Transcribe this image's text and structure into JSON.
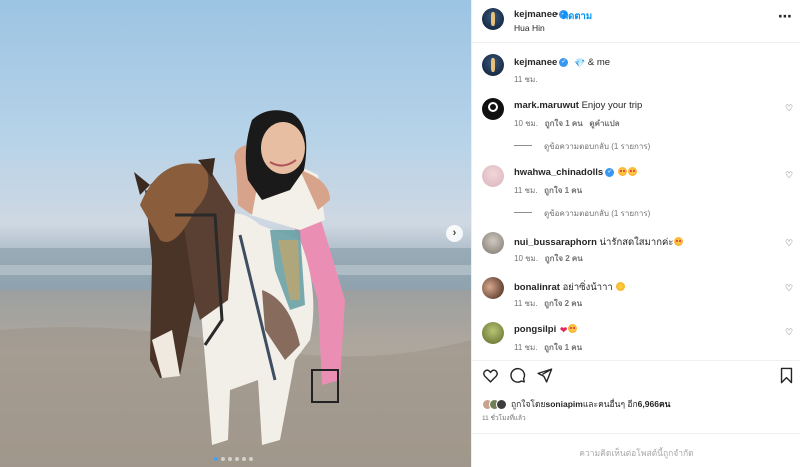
{
  "header": {
    "username": "kejmanee",
    "follow_label": "ติดตาม",
    "separator": "•",
    "location": "Hua Hin",
    "more_label": "⋯"
  },
  "caption": {
    "username": "kejmanee",
    "text": "& me",
    "time": "11 ชม."
  },
  "comments": [
    {
      "username": "mark.maruwut",
      "text": "Enjoy your trip",
      "time": "10 ชม.",
      "likes": "ถูกใจ 1 คน",
      "extra": "ดูคำแปล",
      "avatar_color": "#111111"
    },
    {
      "username": "hwahwa_chinadolls",
      "text": "",
      "time": "11 ชม.",
      "likes": "ถูกใจ 1 คน",
      "avatar_color": "#e9c6cf"
    },
    {
      "username": "nui_bussaraphorn",
      "text": "น่ารักสดใสมากค่ะ",
      "time": "10 ชม.",
      "likes": "ถูกใจ 2 คน",
      "avatar_color": "#8f8a83"
    },
    {
      "username": "bonalinrat",
      "text": "อย่าซิ่งน้าาา",
      "time": "11 ชม.",
      "likes": "ถูกใจ 2 คน",
      "avatar_color": "#6b4a3a"
    },
    {
      "username": "pongsilpi",
      "text": "",
      "time": "11 ชม.",
      "likes": "ถูกใจ 1 คน",
      "avatar_color": "#7c8a3e"
    }
  ],
  "replies": [
    {
      "label": "ดูข้อความตอบกลับ (1 รายการ)"
    },
    {
      "label": "ดูข้อความตอบกลับ (1 รายการ)"
    }
  ],
  "liked_by": {
    "prefix": "ถูกใจโดย ",
    "user": "soniapim",
    "suffix": " และคนอื่นๆ อีก ",
    "count": "6,966",
    "unit": " คน"
  },
  "post_time": "11 ชั่วโมงที่แล้ว",
  "comments_off": "ความคิดเห็นต่อโพสต์นี้ถูกจำกัด",
  "icons": {
    "verified": "verified-badge-icon",
    "heart": "heart-icon",
    "comment": "comment-icon",
    "share": "share-icon",
    "save": "bookmark-icon",
    "next": "chevron-right-icon"
  },
  "carousel": {
    "total_slides": 6,
    "active_index": 0
  },
  "colors": {
    "accent": "#0095f6",
    "verified": "#3897f0",
    "muted": "#737373"
  }
}
